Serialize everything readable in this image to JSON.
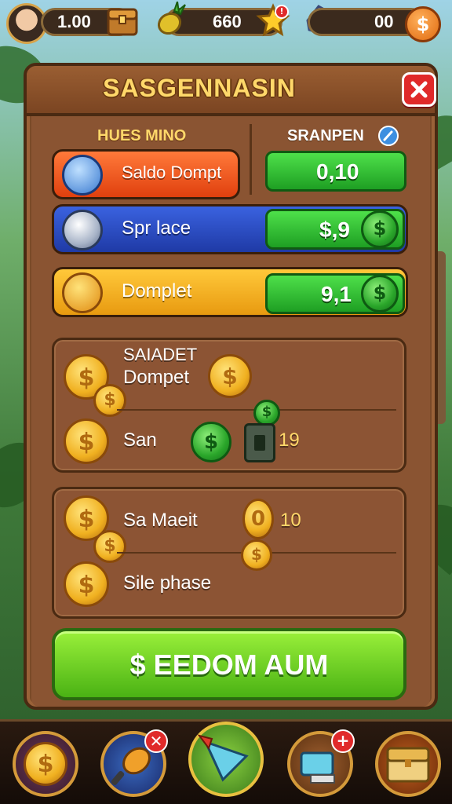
{
  "topbar": {
    "resources": [
      {
        "value": "1.00",
        "icon": "treasure-chest-icon"
      },
      {
        "value": "660",
        "icon": "pineapple-icon"
      },
      {
        "value": "00",
        "icon": "gem-icon"
      }
    ],
    "avatar": "player-avatar-icon",
    "notification": "!"
  },
  "panel": {
    "title": "SASGENNASIN",
    "close_icon": "close-icon"
  },
  "columns": {
    "left": "HUES MINO",
    "right": "SRANPEN"
  },
  "rows": [
    {
      "label": "Saldo Dompt",
      "value": "0,10",
      "color": "#f0561e",
      "icon": "shield-gem-icon"
    },
    {
      "label": "Spr lace",
      "value": "$,9",
      "color": "#2f52c8",
      "icon": "silver-coin-icon"
    },
    {
      "label": "Domplet",
      "value": "9,1",
      "color": "#f2a814",
      "icon": "gold-coin-icon"
    }
  ],
  "card1": {
    "title_line1": "SAIADET",
    "title_line2": "Dompet",
    "item_label": "San",
    "item_value": "19"
  },
  "card2": {
    "line1": "Sa Maeit",
    "line1_value": "10",
    "line2": "Sile phase"
  },
  "cta": {
    "label": "$ EEDOM AUM"
  },
  "bottom_nav": [
    {
      "icon": "coin-icon"
    },
    {
      "icon": "potion-icon",
      "badge": "✕"
    },
    {
      "icon": "sword-icon"
    },
    {
      "icon": "box-icon",
      "badge": "+"
    },
    {
      "icon": "treasure-chest-icon"
    }
  ]
}
